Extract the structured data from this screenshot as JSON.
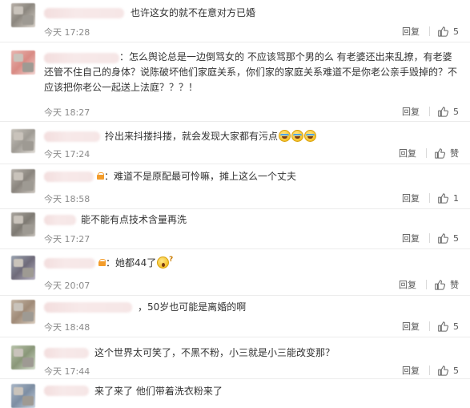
{
  "comments": [
    {
      "text": "也许这女的就不在意对方已婚",
      "time": "今天 17:28",
      "reply": "回复",
      "likes": "5"
    },
    {
      "text": "：怎么舆论总是一边倒骂女的 不应该骂那个男的么 有老婆还出来乱撩，有老婆还管不住自己的身体？说陈破坏他们家庭关系，你们家的家庭关系难道不是你老公亲手毁掉的？不应该把你老公一起送上法庭？？？！",
      "time": "今天 18:27",
      "reply": "回复",
      "likes": "5"
    },
    {
      "text": "拎出来抖搂抖搂，就会发现大家都有污点",
      "time": "今天 17:24",
      "reply": "回复",
      "likes": "赞"
    },
    {
      "text": "：难道不是原配最可怜嘛，摊上这么一个丈夫",
      "time": "今天 18:58",
      "reply": "回复",
      "likes": "1"
    },
    {
      "text": "能不能有点技术含量再洗",
      "time": "今天 17:27",
      "reply": "回复",
      "likes": "5"
    },
    {
      "text": "：她都44了",
      "time": "今天 20:07",
      "reply": "回复",
      "likes": "赞"
    },
    {
      "text": "，50岁也可能是离婚的啊",
      "time": "今天 18:48",
      "reply": "回复",
      "likes": "5"
    },
    {
      "text": "这个世界太可笑了，不黑不粉，小三就是小三能改变那？",
      "time": "今天 17:44",
      "reply": "回复",
      "likes": "5"
    },
    {
      "text": "来了来了 他们带着洗衣粉来了",
      "time": "",
      "reply": "",
      "likes": ""
    }
  ],
  "icons": {
    "thumb": "thumbs-up-icon",
    "badge": "verified-badge-icon",
    "laugh": "laugh-tears-emoji",
    "wow": "surprised-emoji"
  },
  "colors": {
    "time": "#8a8a8a",
    "divider": "#ececec",
    "emoji": "#f5c12b",
    "badge": "#f39c2a"
  }
}
